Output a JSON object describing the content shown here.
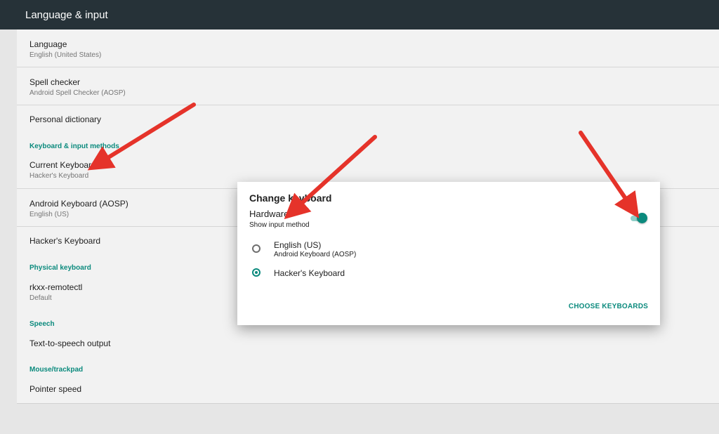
{
  "appbar": {
    "title": "Language & input"
  },
  "settings": {
    "language": {
      "title": "Language",
      "summary": "English (United States)"
    },
    "spell_checker": {
      "title": "Spell checker",
      "summary": "Android Spell Checker (AOSP)"
    },
    "personal_dictionary": {
      "title": "Personal dictionary"
    },
    "category_keyboard": "Keyboard & input methods",
    "current_keyboard": {
      "title": "Current Keyboard",
      "summary": "Hacker's Keyboard"
    },
    "android_keyboard": {
      "title": "Android Keyboard (AOSP)",
      "summary": "English (US)"
    },
    "hackers_keyboard": {
      "title": "Hacker's Keyboard"
    },
    "category_physical": "Physical keyboard",
    "rkxx": {
      "title": "rkxx-remotectl",
      "summary": "Default"
    },
    "category_speech": "Speech",
    "tts": {
      "title": "Text-to-speech output"
    },
    "category_mouse": "Mouse/trackpad",
    "pointer_speed": {
      "title": "Pointer speed"
    }
  },
  "dialog": {
    "title": "Change keyboard",
    "hardware_title": "Hardware",
    "hardware_summary": "Show input method",
    "hardware_toggle_on": true,
    "options": [
      {
        "title": "English (US)",
        "summary": "Android Keyboard (AOSP)",
        "selected": false
      },
      {
        "title": "Hacker's Keyboard",
        "selected": true
      }
    ],
    "choose_button": "CHOOSE KEYBOARDS"
  },
  "colors": {
    "accent": "#0b8a7d",
    "appbar": "#263238",
    "annotation_arrow": "#e5332a"
  },
  "icons": {
    "radio_unchecked": "radio-unchecked-icon",
    "radio_checked": "radio-checked-icon",
    "toggle": "switch-on-icon",
    "annotation": "red-arrow-icon"
  }
}
